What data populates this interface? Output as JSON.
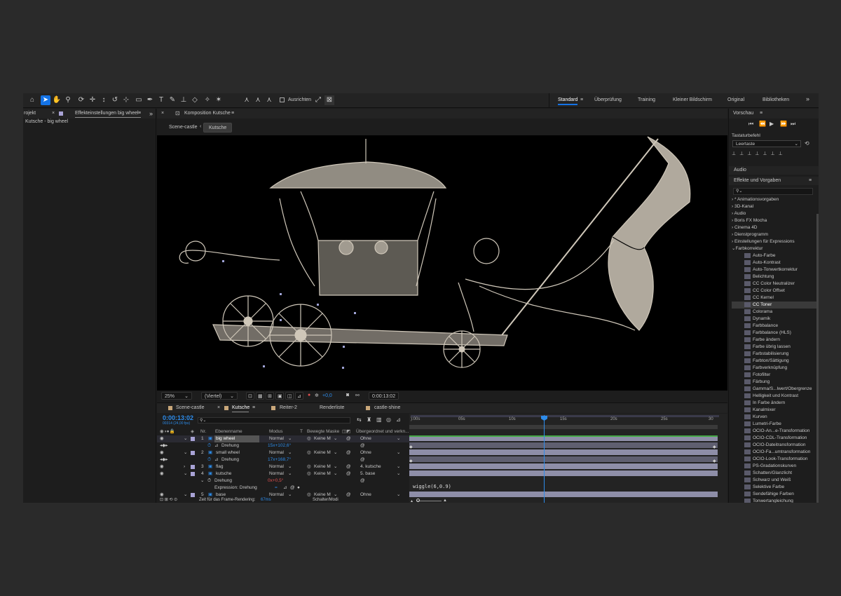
{
  "toolbar": {
    "align_label": "Ausrichten",
    "workspaces": [
      "Standard",
      "Überprüfung",
      "Training",
      "Kleiner Bildschirm",
      "Original",
      "Bibliotheken"
    ],
    "more": "»"
  },
  "left_panel": {
    "tab_project": "rojekt",
    "tab_effects": "Effekteinstellungen big wheel",
    "subtitle": "Kutsche - big wheel"
  },
  "comp_panel": {
    "tab": "Komposition Kutsche",
    "breadcrumbs": [
      "Scene-castle",
      "Kutsche"
    ],
    "zoom": "25%",
    "resolution": "(Viertel)",
    "exposure": "+0,0",
    "timecode": "0:00:13:02"
  },
  "timeline": {
    "tabs": [
      "Scene-castle",
      "Kutsche",
      "Reiter-2",
      "Renderliste",
      "castle-shine"
    ],
    "timecode": "0:00:13:02",
    "frame_info": "00314 (24,00 fps)",
    "headers": {
      "nr": "Nr.",
      "name": "Ebenenname",
      "mode": "Modus",
      "t": "T",
      "mask": "Bewegte Maske",
      "parent": "Übergeordnet und verkn..."
    },
    "rows": [
      {
        "nr": "1",
        "name": "big wheel",
        "mode": "Normal",
        "mask": "Keine M",
        "parent": "Ohne"
      },
      {
        "prop": "Drehung",
        "value": "15x+102,6°"
      },
      {
        "nr": "2",
        "name": "small wheel",
        "mode": "Normal",
        "mask": "Keine M",
        "parent": "Ohne"
      },
      {
        "prop": "Drehung",
        "value": "17x+168,7°"
      },
      {
        "nr": "3",
        "name": "flag",
        "mode": "Normal",
        "mask": "Keine M",
        "parent": "4. kutsche"
      },
      {
        "nr": "4",
        "name": "kutsche",
        "mode": "Normal",
        "mask": "Keine M",
        "parent": "5. base"
      },
      {
        "prop": "Drehung",
        "value": "0x+0,5°"
      },
      {
        "prop": "Expression: Drehung",
        "value": ""
      },
      {
        "nr": "5",
        "name": "base",
        "mode": "Normal",
        "mask": "Keine M",
        "parent": "Ohne"
      }
    ],
    "ruler": [
      "):00s",
      "05s",
      "10s",
      "15s",
      "20s",
      "25s",
      "30"
    ],
    "expression": "wiggle(6,0.9)",
    "render_time_label": "Zeit für das Frame-Rendering:",
    "render_time_value": "67ms",
    "switch_label": "Schalter/Modi"
  },
  "right_panel": {
    "preview": "Vorschau",
    "shortcut_label": "Tastaturbefehl",
    "shortcut_value": "Leertaste",
    "audio": "Audio",
    "effects_title": "Effekte und Vorgaben",
    "categories": [
      "* Animationsvorgaben",
      "3D-Kanal",
      "Audio",
      "Boris FX Mocha",
      "Cinema 4D",
      "Dienstprogramm",
      "Einstellungen für Expressions",
      "Farbkorrektur"
    ],
    "effects": [
      "Auto-Farbe",
      "Auto-Kontrast",
      "Auto-Tonwertkorrektur",
      "Belichtung",
      "CC Color Neutralizer",
      "CC Color Offset",
      "CC Kernel",
      "CC Toner",
      "Colorama",
      "Dynamik",
      "Farbbalance",
      "Farbbalance (HLS)",
      "Farbe ändern",
      "Farbe übrig lassen",
      "Farbstabilisierung",
      "Farbton/Sättigung",
      "Farbverknüpfung",
      "Fotofilter",
      "Färbung",
      "Gamma/S...lwert/Obergrenze",
      "Helligkeit und Kontrast",
      "In Farbe ändern",
      "Kanalmixer",
      "Kurven",
      "Lumetri-Farbe",
      "OCIO-An...e-Transformation",
      "OCIO-CDL-Transformation",
      "OCIO-Dateitransformation",
      "OCIO-Fa...umtransformation",
      "OCIO-Look-Transformation",
      "PS-Gradationskurven",
      "Schatten/Glanzlicht",
      "Schwarz und Weiß",
      "Selektive Farbe",
      "Sendefähige Farben",
      "Tonwertangleichung"
    ],
    "selected_effect": "CC Toner"
  },
  "colors": {
    "accent": "#1473e6",
    "timecode": "#2d8ceb",
    "layer_bar": "#8e8ea8",
    "label_lavender": "#a9a3d6"
  }
}
